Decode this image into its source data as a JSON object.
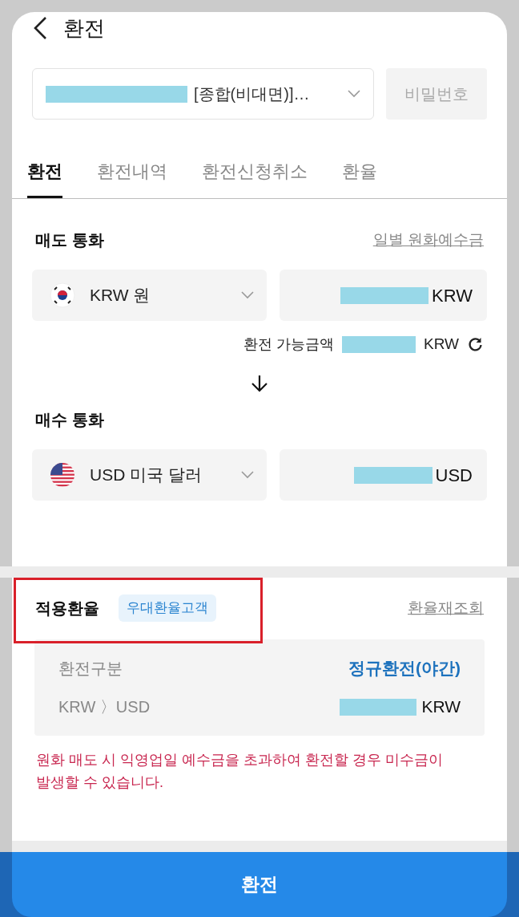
{
  "header": {
    "title": "환전"
  },
  "account": {
    "name": "[종합(비대면)]…",
    "action": "비밀번호"
  },
  "tabs": [
    {
      "label": "환전",
      "selected": true
    },
    {
      "label": "환전내역",
      "selected": false
    },
    {
      "label": "환전신청취소",
      "selected": false
    },
    {
      "label": "환율",
      "selected": false
    }
  ],
  "sell": {
    "title": "매도 통화",
    "link": "일별 원화예수금",
    "kind": "kr",
    "currency": "KRW 원",
    "unit": "KRW",
    "available_label": "환전 가능금액",
    "available_unit": "KRW"
  },
  "buy": {
    "title": "매수 통화",
    "kind": "us",
    "currency": "USD 미국 달러",
    "unit": "USD"
  },
  "rate": {
    "title": "적용환율",
    "badge": "우대환율고객",
    "link": "환율재조회",
    "highlighted": true,
    "rows": [
      {
        "kind": "text",
        "label": "환전구분",
        "value": "정규환전(야간)"
      },
      {
        "kind": "amount",
        "label": "KRW 〉USD",
        "unit": "KRW"
      }
    ],
    "notice": "원화 매도 시 익영업일 예수금을 초과하여 환전할 경우 미수금이 발생할 수 있습니다."
  },
  "submit": "환전"
}
